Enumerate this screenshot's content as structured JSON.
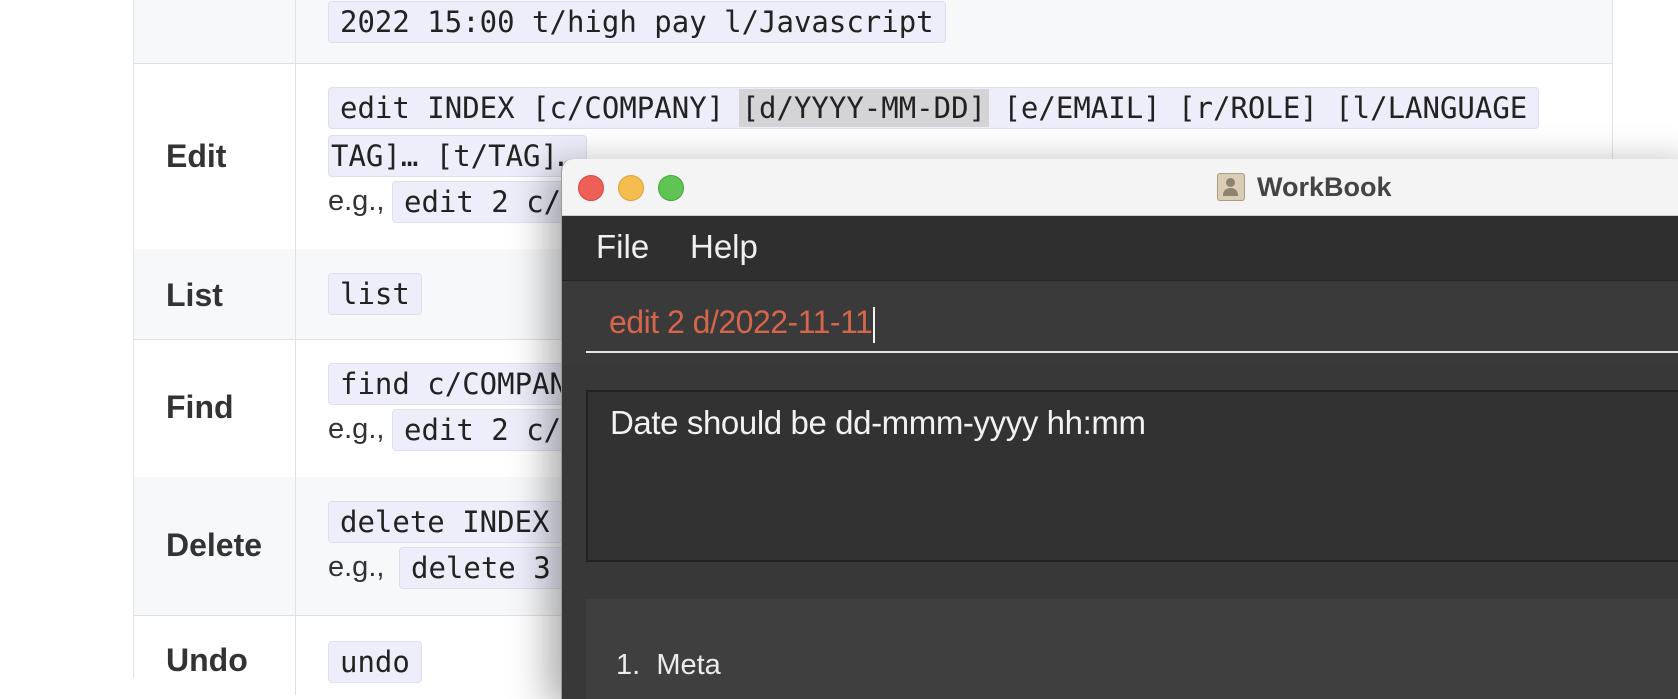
{
  "doc_table": {
    "top_row": {
      "code": "2022 15:00 t/high pay l/Javascript"
    },
    "rows": [
      {
        "action": "Edit",
        "format_line1_before": "edit INDEX [c/COMPANY] ",
        "format_line1_highlight": "[d/YYYY-MM-DD]",
        "format_line1_after": " [e/EMAIL] [r/ROLE] [l/LANGUAGE",
        "format_line2": "TAG]… [t/TAG]…",
        "example_prefix": "e.g.,",
        "example_code": "edit 2 c/"
      },
      {
        "action": "List",
        "format": "list"
      },
      {
        "action": "Find",
        "format": "find c/COMPAN",
        "example_prefix": "e.g.,",
        "example_code": "edit 2 c/"
      },
      {
        "action": "Delete",
        "format": "delete INDEX",
        "example_prefix": "e.g.,",
        "example_code": "delete 3"
      },
      {
        "action": "Undo",
        "format": "undo"
      }
    ]
  },
  "window": {
    "title": "WorkBook",
    "menu": [
      "File",
      "Help"
    ],
    "command_input": {
      "value": "edit 2 d/2022-11-11"
    },
    "result_message": "Date should be dd-mmm-yyyy hh:mm",
    "list": [
      {
        "index": "1.",
        "company": "Meta"
      }
    ],
    "colors": {
      "command_text": "#d5654b",
      "background": "#383838"
    }
  }
}
